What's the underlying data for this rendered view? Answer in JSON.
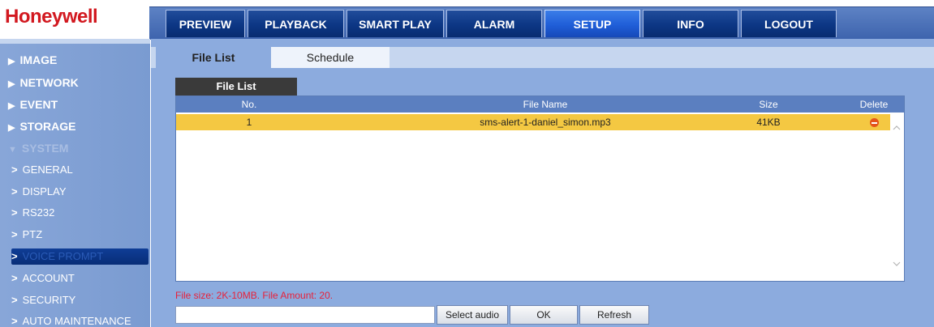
{
  "brand": {
    "logo": "Honeywell"
  },
  "nav": {
    "tabs": [
      "PREVIEW",
      "PLAYBACK",
      "SMART PLAY",
      "ALARM",
      "SETUP",
      "INFO",
      "LOGOUT"
    ],
    "active": "SETUP"
  },
  "sidebar": {
    "categories": [
      "IMAGE",
      "NETWORK",
      "EVENT",
      "STORAGE",
      "SYSTEM"
    ],
    "system_items": [
      "GENERAL",
      "DISPLAY",
      "RS232",
      "PTZ",
      "VOICE PROMPT",
      "ACCOUNT",
      "SECURITY",
      "AUTO MAINTENANCE"
    ],
    "active_item": "VOICE PROMPT"
  },
  "content": {
    "tabs": [
      "File List",
      "Schedule"
    ],
    "active_tab": "File List",
    "panel_title": "File List",
    "table": {
      "headers": [
        "No.",
        "File Name",
        "Size",
        "Delete"
      ],
      "rows": [
        {
          "no": "1",
          "file_name": "sms-alert-1-daniel_simon.mp3",
          "size": "41KB"
        }
      ]
    },
    "note": "File size: 2K-10MB. File Amount: 20.",
    "audio_path": {
      "value": "",
      "placeholder": ""
    },
    "buttons": {
      "select": "Select audio",
      "ok": "OK",
      "refresh": "Refresh"
    }
  },
  "icons": {
    "delete": "delete-minus-circle-icon",
    "scroll_up": "chevron-up-icon",
    "scroll_down": "chevron-down-icon",
    "collapsed": "triangle-right-icon",
    "expanded": "triangle-down-icon",
    "sub": "chevron-right-icon"
  },
  "colors": {
    "brand_red": "#d2181f",
    "nav_blue": "#0c3684",
    "nav_active": "#1f5ed8",
    "row_highlight": "#f4c842",
    "delete_orange": "#e4541a",
    "note_red": "#e8213a"
  }
}
